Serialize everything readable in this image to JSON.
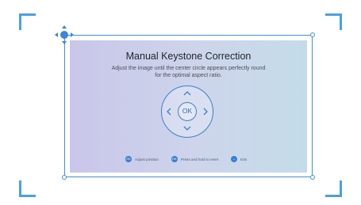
{
  "panel": {
    "title": "Manual Keystone Correction",
    "subtitle_line1": "Adjust the image until the center circle appears perfectly round",
    "subtitle_line2": "for the optimal aspect ratio."
  },
  "dpad": {
    "ok_label": "OK",
    "up_icon": "chevron-up-icon",
    "down_icon": "chevron-down-icon",
    "left_icon": "chevron-left-icon",
    "right_icon": "chevron-right-icon"
  },
  "hints": [
    {
      "badge": "OK",
      "label": "Adjust position"
    },
    {
      "badge": "OK",
      "label": "Press and hold to reset"
    },
    {
      "badge": "←",
      "label": "Exit"
    }
  ],
  "colors": {
    "accent": "#3a86d8",
    "frame": "#4aa0e6"
  }
}
